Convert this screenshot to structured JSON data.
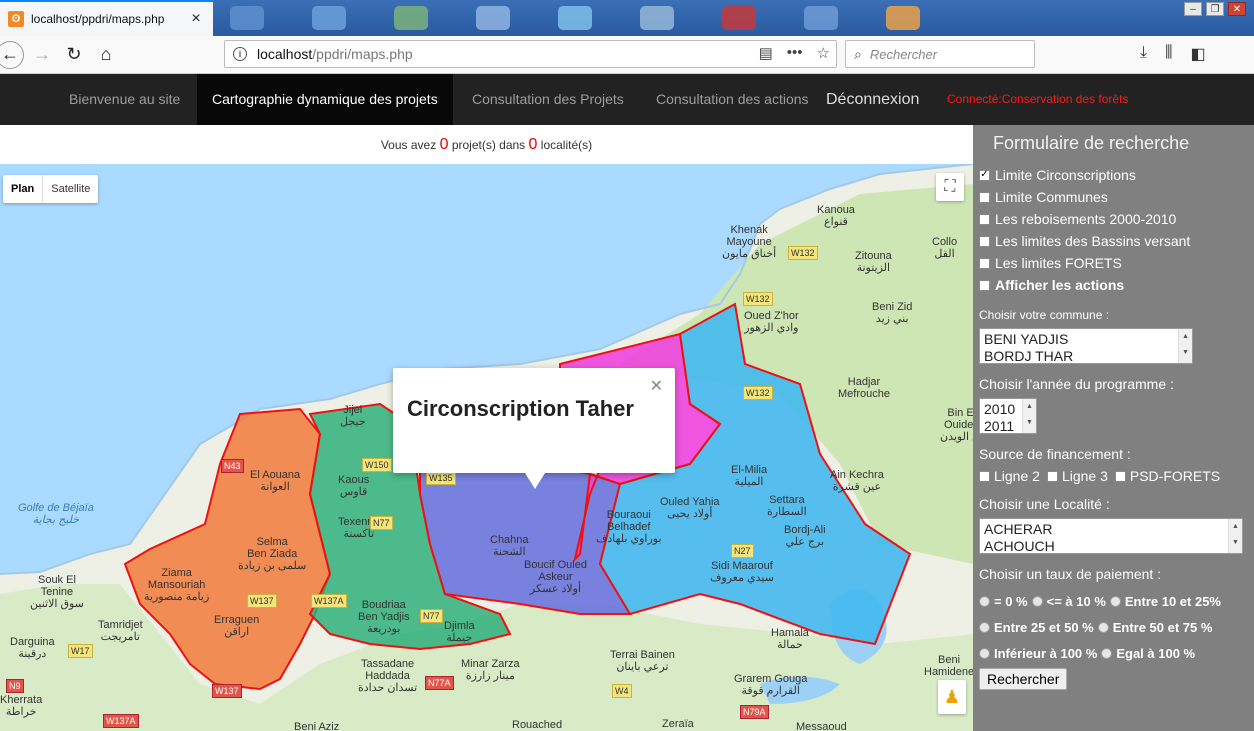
{
  "browser": {
    "tab_title": "localhost/ppdri/maps.php",
    "url_host": "localhost",
    "url_path": "/ppdri/maps.php",
    "search_placeholder": "Rechercher"
  },
  "sitenav": {
    "items": [
      "Bienvenue au site",
      "Cartographie dynamique des projets",
      "Consultation des Projets",
      "Consultation des actions"
    ],
    "logout": "Déconnexion",
    "connected": "Connecté:Conservation des forêts"
  },
  "count": {
    "prefix": "Vous avez",
    "projects": "0",
    "middle": "projet(s) dans",
    "localities": "0",
    "suffix": "localité(s)"
  },
  "map": {
    "type_plan": "Plan",
    "type_satellite": "Satellite",
    "popup_title": "Circonscription Taher",
    "labels": [
      {
        "t": "Khenak\nMayoune\nأخناق مايون"
      },
      {
        "t": "Kanoua\nقنواع"
      },
      {
        "t": "Zitouna\nالزيتونة"
      },
      {
        "t": "Collo\nالقل"
      },
      {
        "t": "Beni Zid\nبني زيد"
      },
      {
        "t": "Oued Z'hor\nوادي الزهور"
      },
      {
        "t": "Hadjar\nMefrouche"
      },
      {
        "t": "Bin El\nOuiden\nبن الويدن"
      },
      {
        "t": "Ain Kechra\nعين قشرة"
      },
      {
        "t": "El-Milia\nالميلية"
      },
      {
        "t": "Ouled Yahia\nأولاد يحيى"
      },
      {
        "t": "Settara\nالسطارة"
      },
      {
        "t": "Bordj-Ali\nبرج علي"
      },
      {
        "t": "Sidi Maarouf\nسيدي معروف"
      },
      {
        "t": "Bouraoui\nBelhadef\nبوراوي بلهادف"
      },
      {
        "t": "Chahna\nالشحنة"
      },
      {
        "t": "Boucif Ouled\nAskeur\nأولاد عسكر"
      },
      {
        "t": "Kaous\nقاوس"
      },
      {
        "t": "Texenna\nتاكسنة"
      },
      {
        "t": "Boudriaa\nBen Yadjis\nبودريعة"
      },
      {
        "t": "Djimla\nجيملة"
      },
      {
        "t": "El Aouana\nالعوانة"
      },
      {
        "t": "Selma\nBen Ziada\nسلمى بن زيادة"
      },
      {
        "t": "Ziama\nMansouriah\nزيامة منصورية"
      },
      {
        "t": "Erraguen\nاراقن"
      },
      {
        "t": "Souk El\nTenine\nسوق الاثنين"
      },
      {
        "t": "Tamridjet\nتامريجت"
      },
      {
        "t": "Darguina\nدرقينة"
      },
      {
        "t": "Tassadane\nHaddada\nتسدان حدادة"
      },
      {
        "t": "Minar Zarza\nمينار زارزة"
      },
      {
        "t": "Terrai Bainen\nترعي باينان"
      },
      {
        "t": "Hamala\nحمالة"
      },
      {
        "t": "Grarem Gouga\nالقرارم قوقة"
      },
      {
        "t": "Beni\nHamidene"
      },
      {
        "t": "Rouached"
      },
      {
        "t": "Zeraïa"
      },
      {
        "t": "Messaoud"
      },
      {
        "t": "Beni Aziz"
      },
      {
        "t": "Kherrata\nخراطة"
      },
      {
        "t": "Jijel\nجيجل"
      }
    ],
    "water_label": "Golfe de Béjaïa\nخليج بجاية",
    "roads": [
      "W132",
      "W132",
      "W132",
      "N43",
      "W150",
      "W135",
      "N77",
      "N77",
      "N27",
      "W137",
      "W137A",
      "W137",
      "N9",
      "W17",
      "N77A",
      "W4",
      "N79A",
      "W137A"
    ]
  },
  "sidebar": {
    "title": "Formulaire de recherche",
    "layers": [
      {
        "label": "Limite Circonscriptions",
        "checked": true
      },
      {
        "label": "Limite Communes",
        "checked": false
      },
      {
        "label": "Les reboisements 2000-2010",
        "checked": false
      },
      {
        "label": "Les limites des Bassins versant",
        "checked": false
      },
      {
        "label": "Les limites FORETS",
        "checked": false
      },
      {
        "label": "Afficher les actions",
        "checked": false
      }
    ],
    "commune_label": "Choisir votre commune :",
    "communes": [
      "BENI YADJIS",
      "BORDJ THAR"
    ],
    "annee_label": "Choisir l'année du programme :",
    "annees": [
      "2010",
      "2011"
    ],
    "financement_label": "Source de financement :",
    "financements": [
      "Ligne 2",
      "Ligne 3",
      "PSD-FORETS"
    ],
    "localite_label": "Choisir une Localité :",
    "localites": [
      "ACHERAR",
      "ACHOUCH"
    ],
    "taux_label": "Choisir un taux de paiement :",
    "taux": [
      [
        "= 0 %",
        "<= à 10 %",
        "Entre 10 et 25%"
      ],
      [
        "Entre 25 et 50 %",
        "Entre 50 et 75 %"
      ],
      [
        "Inférieur à 100 %",
        "Egal à 100 %"
      ]
    ],
    "search_button": "Rechercher"
  }
}
